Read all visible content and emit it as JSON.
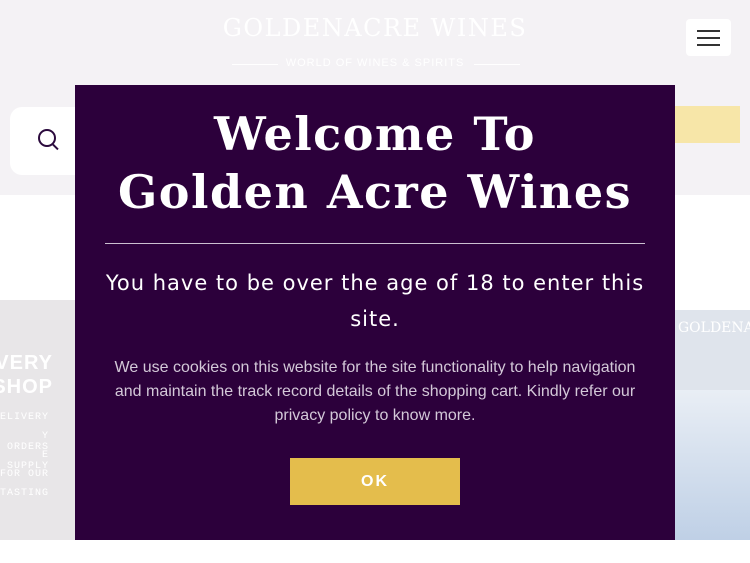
{
  "header": {
    "brand": "GOLDENACRE WINES",
    "tagline": "WORLD OF WINES & SPIRITS"
  },
  "search": {
    "icon": "search-icon"
  },
  "menu": {
    "icon": "hamburger-icon"
  },
  "promo_left": {
    "heading": [
      "VERY",
      "SHOP"
    ],
    "lines": [
      "DELIVERY",
      "Y ORDERS",
      "E SUPPLY",
      "FOR OUR",
      "TASTING"
    ]
  },
  "promo_right": {
    "title": "GOLDENACRE"
  },
  "modal": {
    "title_line1": "Welcome To",
    "title_line2": "Golden Acre Wines",
    "age_notice": "You have to be over the age of 18 to enter this site.",
    "cookie_notice": "We use cookies on this website for the site functionality to help navigation and maintain the track record details of the shopping cart. Kindly refer our privacy policy to know more.",
    "ok_label": "OK"
  },
  "colors": {
    "modal_bg": "#2c003b",
    "accent_gold": "#e4bd4c",
    "header_bg": "#f4f2f5"
  }
}
